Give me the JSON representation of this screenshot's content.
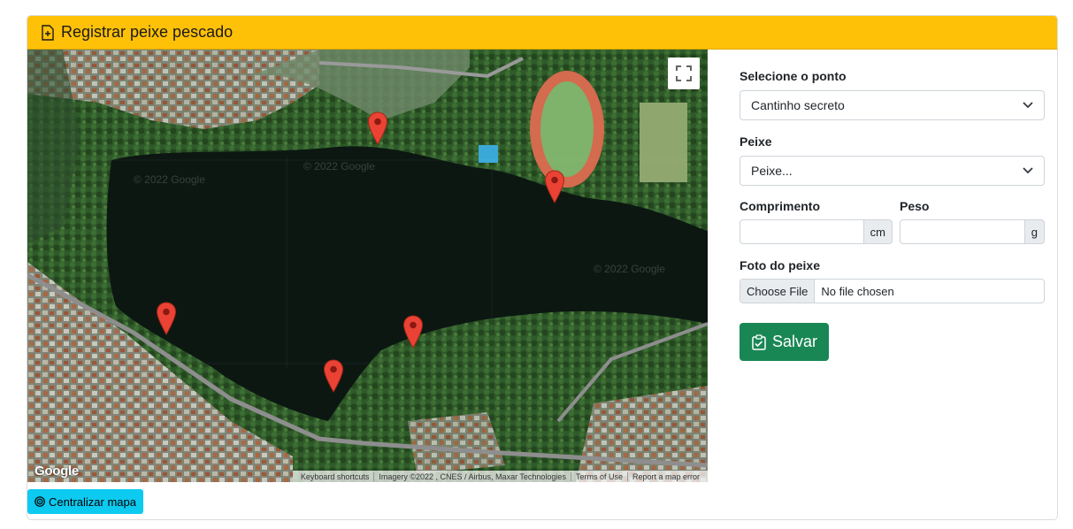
{
  "header": {
    "title": "Registrar peixe pescado",
    "icon": "file-plus-icon",
    "color": "#ffc107"
  },
  "map": {
    "watermarks": [
      "© 2022 Google",
      "© 2022 Google",
      "© 2022 Google"
    ],
    "google_logo": "Google",
    "attribution": {
      "keyboard": "Keyboard shortcuts",
      "imagery": "Imagery ©2022 , CNES / Airbus, Maxar Technologies",
      "terms": "Terms of Use",
      "report": "Report a map error"
    },
    "fullscreen_icon": "fullscreen-icon",
    "marker_color": "#ea4335",
    "marker_count": 5
  },
  "center_button": {
    "label": "Centralizar mapa",
    "icon": "target-icon",
    "color": "#0dcaf0"
  },
  "form": {
    "ponto": {
      "label": "Selecione o ponto",
      "value": "Cantinho secreto"
    },
    "peixe": {
      "label": "Peixe",
      "value": "Peixe..."
    },
    "comprimento": {
      "label": "Comprimento",
      "unit": "cm",
      "value": ""
    },
    "peso": {
      "label": "Peso",
      "unit": "g",
      "value": ""
    },
    "foto": {
      "label": "Foto do peixe",
      "button": "Choose File",
      "status": "No file chosen"
    },
    "save": {
      "label": "Salvar",
      "icon": "clipboard-check-icon",
      "color": "#198754"
    }
  }
}
